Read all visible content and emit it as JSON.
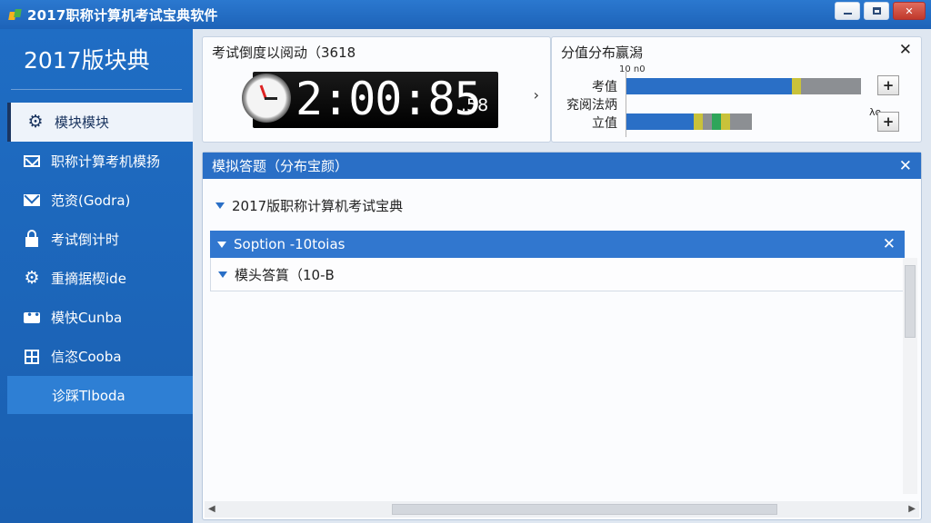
{
  "window": {
    "title": "2017职称计算机考试宝典软件",
    "min_label": "",
    "max_label": "",
    "close_label": "✕"
  },
  "sidebar": {
    "brand": "2017版块典",
    "items": [
      {
        "label": "模块模块",
        "icon": "gear-icon"
      },
      {
        "label": "职称计算考机模扬",
        "icon": "mail-icon"
      },
      {
        "label": "范资(Godra)",
        "icon": "envelope-icon"
      },
      {
        "label": "考试倒计时",
        "icon": "lock-icon"
      },
      {
        "label": "重摘据楔ide",
        "icon": "gear-icon"
      },
      {
        "label": "模快Cunba",
        "icon": "chat-icon"
      },
      {
        "label": "信恣Cooba",
        "icon": "grid-icon"
      },
      {
        "label": "诊踩Tlboda",
        "icon": ""
      }
    ]
  },
  "timer": {
    "title": "考试倒度以阅动（3618",
    "digits": "2:00:85",
    "small": ".58",
    "chevron": "›"
  },
  "score": {
    "title": "分值分布赢潟",
    "close": "✕",
    "top_label": "10 n0",
    "rows": [
      {
        "label": "考值"
      },
      {
        "label": "兖阅法炳"
      },
      {
        "label": "立值"
      }
    ],
    "side_label": "λo",
    "plus_label": "+"
  },
  "exam": {
    "title": "模拟答题（分布宝颜）",
    "close": "✕",
    "tree_root": "2017版职称计算机考试宝典",
    "section_header": "Soption -10toias",
    "section_close": "✕",
    "section_item": "模头答篔（10-B"
  },
  "colors": {
    "accent": "#2a6fc6",
    "sidebar_bg": "#1a5fb0",
    "bar_blue": "#2a6fc6",
    "bar_yellow": "#c9c23a",
    "bar_green": "#2fa55a",
    "bar_gray": "#8c8f93"
  }
}
